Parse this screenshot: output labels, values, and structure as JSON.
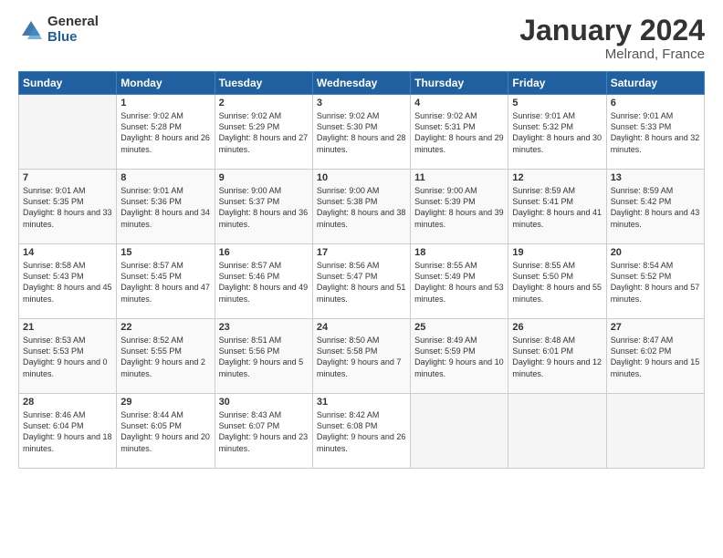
{
  "header": {
    "logo": {
      "general": "General",
      "blue": "Blue"
    },
    "title": "January 2024",
    "location": "Melrand, France"
  },
  "days_of_week": [
    "Sunday",
    "Monday",
    "Tuesday",
    "Wednesday",
    "Thursday",
    "Friday",
    "Saturday"
  ],
  "weeks": [
    [
      {
        "day": "",
        "empty": true
      },
      {
        "day": "1",
        "sunrise": "Sunrise: 9:02 AM",
        "sunset": "Sunset: 5:28 PM",
        "daylight": "Daylight: 8 hours and 26 minutes."
      },
      {
        "day": "2",
        "sunrise": "Sunrise: 9:02 AM",
        "sunset": "Sunset: 5:29 PM",
        "daylight": "Daylight: 8 hours and 27 minutes."
      },
      {
        "day": "3",
        "sunrise": "Sunrise: 9:02 AM",
        "sunset": "Sunset: 5:30 PM",
        "daylight": "Daylight: 8 hours and 28 minutes."
      },
      {
        "day": "4",
        "sunrise": "Sunrise: 9:02 AM",
        "sunset": "Sunset: 5:31 PM",
        "daylight": "Daylight: 8 hours and 29 minutes."
      },
      {
        "day": "5",
        "sunrise": "Sunrise: 9:01 AM",
        "sunset": "Sunset: 5:32 PM",
        "daylight": "Daylight: 8 hours and 30 minutes."
      },
      {
        "day": "6",
        "sunrise": "Sunrise: 9:01 AM",
        "sunset": "Sunset: 5:33 PM",
        "daylight": "Daylight: 8 hours and 32 minutes."
      }
    ],
    [
      {
        "day": "7",
        "sunrise": "Sunrise: 9:01 AM",
        "sunset": "Sunset: 5:35 PM",
        "daylight": "Daylight: 8 hours and 33 minutes."
      },
      {
        "day": "8",
        "sunrise": "Sunrise: 9:01 AM",
        "sunset": "Sunset: 5:36 PM",
        "daylight": "Daylight: 8 hours and 34 minutes."
      },
      {
        "day": "9",
        "sunrise": "Sunrise: 9:00 AM",
        "sunset": "Sunset: 5:37 PM",
        "daylight": "Daylight: 8 hours and 36 minutes."
      },
      {
        "day": "10",
        "sunrise": "Sunrise: 9:00 AM",
        "sunset": "Sunset: 5:38 PM",
        "daylight": "Daylight: 8 hours and 38 minutes."
      },
      {
        "day": "11",
        "sunrise": "Sunrise: 9:00 AM",
        "sunset": "Sunset: 5:39 PM",
        "daylight": "Daylight: 8 hours and 39 minutes."
      },
      {
        "day": "12",
        "sunrise": "Sunrise: 8:59 AM",
        "sunset": "Sunset: 5:41 PM",
        "daylight": "Daylight: 8 hours and 41 minutes."
      },
      {
        "day": "13",
        "sunrise": "Sunrise: 8:59 AM",
        "sunset": "Sunset: 5:42 PM",
        "daylight": "Daylight: 8 hours and 43 minutes."
      }
    ],
    [
      {
        "day": "14",
        "sunrise": "Sunrise: 8:58 AM",
        "sunset": "Sunset: 5:43 PM",
        "daylight": "Daylight: 8 hours and 45 minutes."
      },
      {
        "day": "15",
        "sunrise": "Sunrise: 8:57 AM",
        "sunset": "Sunset: 5:45 PM",
        "daylight": "Daylight: 8 hours and 47 minutes."
      },
      {
        "day": "16",
        "sunrise": "Sunrise: 8:57 AM",
        "sunset": "Sunset: 5:46 PM",
        "daylight": "Daylight: 8 hours and 49 minutes."
      },
      {
        "day": "17",
        "sunrise": "Sunrise: 8:56 AM",
        "sunset": "Sunset: 5:47 PM",
        "daylight": "Daylight: 8 hours and 51 minutes."
      },
      {
        "day": "18",
        "sunrise": "Sunrise: 8:55 AM",
        "sunset": "Sunset: 5:49 PM",
        "daylight": "Daylight: 8 hours and 53 minutes."
      },
      {
        "day": "19",
        "sunrise": "Sunrise: 8:55 AM",
        "sunset": "Sunset: 5:50 PM",
        "daylight": "Daylight: 8 hours and 55 minutes."
      },
      {
        "day": "20",
        "sunrise": "Sunrise: 8:54 AM",
        "sunset": "Sunset: 5:52 PM",
        "daylight": "Daylight: 8 hours and 57 minutes."
      }
    ],
    [
      {
        "day": "21",
        "sunrise": "Sunrise: 8:53 AM",
        "sunset": "Sunset: 5:53 PM",
        "daylight": "Daylight: 9 hours and 0 minutes."
      },
      {
        "day": "22",
        "sunrise": "Sunrise: 8:52 AM",
        "sunset": "Sunset: 5:55 PM",
        "daylight": "Daylight: 9 hours and 2 minutes."
      },
      {
        "day": "23",
        "sunrise": "Sunrise: 8:51 AM",
        "sunset": "Sunset: 5:56 PM",
        "daylight": "Daylight: 9 hours and 5 minutes."
      },
      {
        "day": "24",
        "sunrise": "Sunrise: 8:50 AM",
        "sunset": "Sunset: 5:58 PM",
        "daylight": "Daylight: 9 hours and 7 minutes."
      },
      {
        "day": "25",
        "sunrise": "Sunrise: 8:49 AM",
        "sunset": "Sunset: 5:59 PM",
        "daylight": "Daylight: 9 hours and 10 minutes."
      },
      {
        "day": "26",
        "sunrise": "Sunrise: 8:48 AM",
        "sunset": "Sunset: 6:01 PM",
        "daylight": "Daylight: 9 hours and 12 minutes."
      },
      {
        "day": "27",
        "sunrise": "Sunrise: 8:47 AM",
        "sunset": "Sunset: 6:02 PM",
        "daylight": "Daylight: 9 hours and 15 minutes."
      }
    ],
    [
      {
        "day": "28",
        "sunrise": "Sunrise: 8:46 AM",
        "sunset": "Sunset: 6:04 PM",
        "daylight": "Daylight: 9 hours and 18 minutes."
      },
      {
        "day": "29",
        "sunrise": "Sunrise: 8:44 AM",
        "sunset": "Sunset: 6:05 PM",
        "daylight": "Daylight: 9 hours and 20 minutes."
      },
      {
        "day": "30",
        "sunrise": "Sunrise: 8:43 AM",
        "sunset": "Sunset: 6:07 PM",
        "daylight": "Daylight: 9 hours and 23 minutes."
      },
      {
        "day": "31",
        "sunrise": "Sunrise: 8:42 AM",
        "sunset": "Sunset: 6:08 PM",
        "daylight": "Daylight: 9 hours and 26 minutes."
      },
      {
        "day": "",
        "empty": true
      },
      {
        "day": "",
        "empty": true
      },
      {
        "day": "",
        "empty": true
      }
    ]
  ]
}
